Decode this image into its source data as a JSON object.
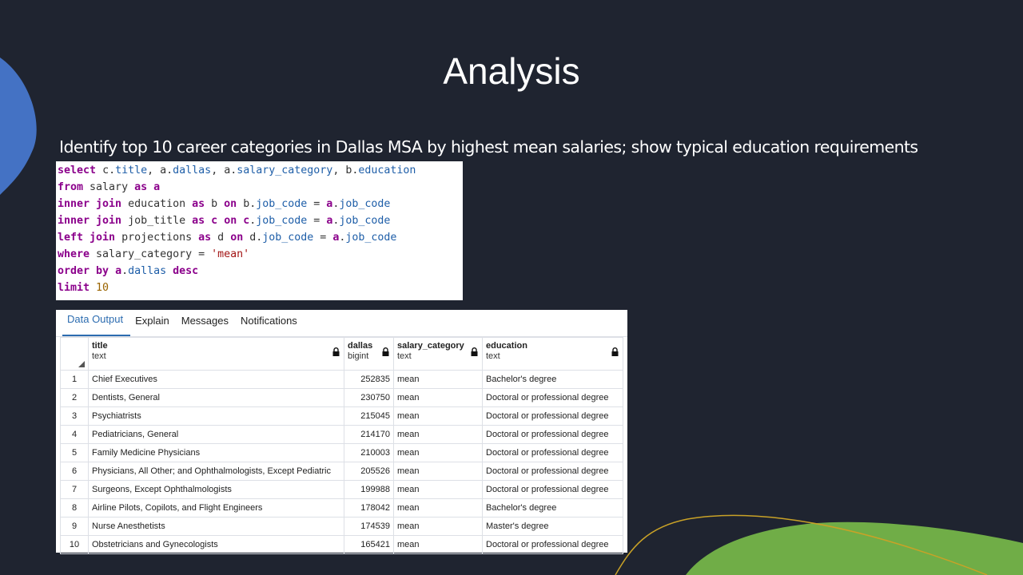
{
  "slide": {
    "title": "Analysis",
    "subtitle": "Identify top 10 career categories in Dallas MSA by highest mean salaries; show typical education requirements"
  },
  "sql": {
    "line1": {
      "k1": "select",
      "p1": "c.",
      "f1": "title",
      ", a.": "",
      "p2": ", a.",
      "f2": "dallas",
      "p3": ", a.",
      "f3": "salary_category",
      "p4": ", b.",
      "f4": "education"
    },
    "line2": {
      "k1": "from",
      "t": " salary ",
      "k2": "as",
      "a": "a"
    },
    "line3": {
      "k1": "inner join",
      "t1": " education ",
      "k2": "as",
      "t2": " b ",
      "k3": "on",
      "t3": " b.",
      "f1": "job_code",
      "t4": " = ",
      "a": "a",
      "t5": ".",
      "f2": "job_code"
    },
    "line4": {
      "k1": "inner join",
      "t1": " job_title ",
      "k2": "as",
      "t2": " ",
      "a1": "c",
      "t3": " ",
      "k3": "on",
      "t4": " ",
      "a2": "c",
      "t5": ".",
      "f1": "job_code",
      "t6": " = ",
      "a3": "a",
      "t7": ".",
      "f2": "job_code"
    },
    "line5": {
      "k1": "left join",
      "t1": " projections ",
      "k2": "as",
      "t2": " d ",
      "k3": "on",
      "t3": " d.",
      "f1": "job_code",
      "t4": " = ",
      "a": "a",
      "t5": ".",
      "f2": "job_code"
    },
    "line6": {
      "k1": "where",
      "t1": " salary_category = ",
      "s": "'mean'"
    },
    "line7": {
      "k1": "order by",
      "t1": " ",
      "a": "a",
      "t2": ".",
      "f": "dallas",
      "t3": " ",
      "k2": "desc"
    },
    "line8": {
      "k1": "limit",
      "t1": " ",
      "n": "10"
    }
  },
  "tabs": [
    {
      "label": "Data Output",
      "active": true
    },
    {
      "label": "Explain",
      "active": false
    },
    {
      "label": "Messages",
      "active": false
    },
    {
      "label": "Notifications",
      "active": false
    }
  ],
  "columns": [
    {
      "name": "title",
      "type": "text"
    },
    {
      "name": "dallas",
      "type": "bigint"
    },
    {
      "name": "salary_category",
      "type": "text"
    },
    {
      "name": "education",
      "type": "text"
    }
  ],
  "rows": [
    {
      "n": "1",
      "title": "Chief Executives",
      "dallas": "252835",
      "cat": "mean",
      "edu": "Bachelor's degree"
    },
    {
      "n": "2",
      "title": "Dentists, General",
      "dallas": "230750",
      "cat": "mean",
      "edu": "Doctoral or professional degree"
    },
    {
      "n": "3",
      "title": "Psychiatrists",
      "dallas": "215045",
      "cat": "mean",
      "edu": "Doctoral or professional degree"
    },
    {
      "n": "4",
      "title": "Pediatricians, General",
      "dallas": "214170",
      "cat": "mean",
      "edu": "Doctoral or professional degree"
    },
    {
      "n": "5",
      "title": "Family Medicine Physicians",
      "dallas": "210003",
      "cat": "mean",
      "edu": "Doctoral or professional degree"
    },
    {
      "n": "6",
      "title": "Physicians, All Other; and Ophthalmologists, Except Pediatric",
      "dallas": "205526",
      "cat": "mean",
      "edu": "Doctoral or professional degree"
    },
    {
      "n": "7",
      "title": "Surgeons, Except Ophthalmologists",
      "dallas": "199988",
      "cat": "mean",
      "edu": "Doctoral or professional degree"
    },
    {
      "n": "8",
      "title": "Airline Pilots, Copilots, and Flight Engineers",
      "dallas": "178042",
      "cat": "mean",
      "edu": "Bachelor's degree"
    },
    {
      "n": "9",
      "title": "Nurse Anesthetists",
      "dallas": "174539",
      "cat": "mean",
      "edu": "Master's degree"
    },
    {
      "n": "10",
      "title": "Obstetricians and Gynecologists",
      "dallas": "165421",
      "cat": "mean",
      "edu": "Doctoral or professional degree"
    }
  ],
  "colors": {
    "background": "#1f2430",
    "blue_shape": "#4472c4",
    "green_shape": "#70ad47",
    "gold_line": "#c9a227",
    "tab_active": "#2c6cb0"
  }
}
